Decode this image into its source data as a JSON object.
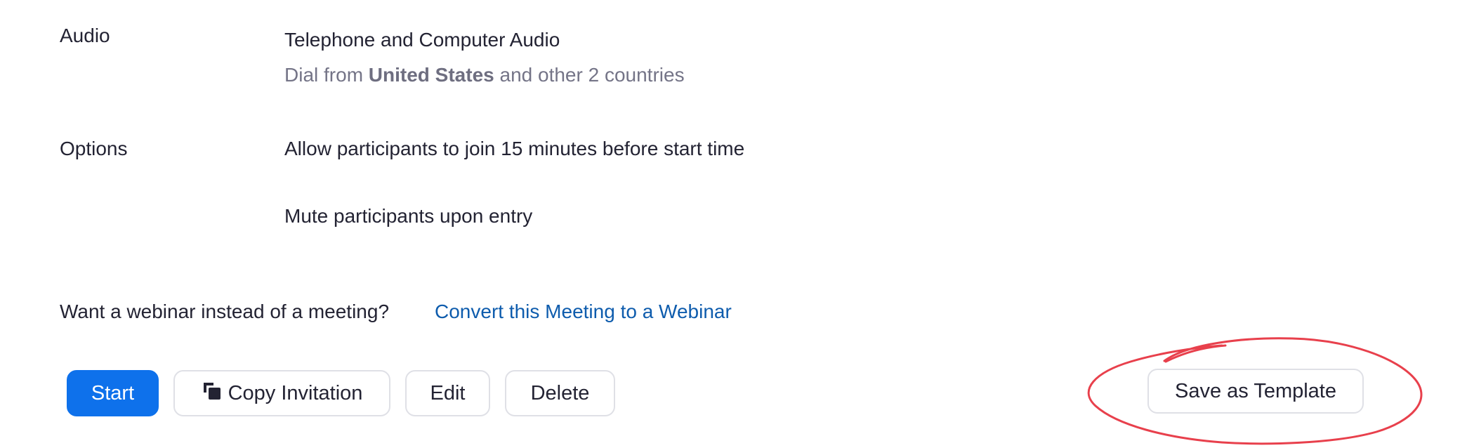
{
  "audio": {
    "label": "Audio",
    "value": "Telephone and Computer Audio",
    "dial_prefix": "Dial from",
    "dial_country": "United States",
    "dial_suffix": "and other 2 countries"
  },
  "options": {
    "label": "Options",
    "items": [
      "Allow participants to join 15 minutes before start time",
      "Mute participants upon entry"
    ]
  },
  "webinar": {
    "prompt": "Want a webinar instead of a meeting?",
    "link": "Convert this Meeting to a Webinar"
  },
  "actions": {
    "start": "Start",
    "copy_invitation": "Copy Invitation",
    "edit": "Edit",
    "delete": "Delete",
    "save_as_template": "Save as Template"
  },
  "colors": {
    "primary": "#0e71eb",
    "link": "#0e5cad",
    "annotation": "#e8404c",
    "muted_text": "#747487"
  },
  "icons": {
    "copy": "copy-icon"
  }
}
